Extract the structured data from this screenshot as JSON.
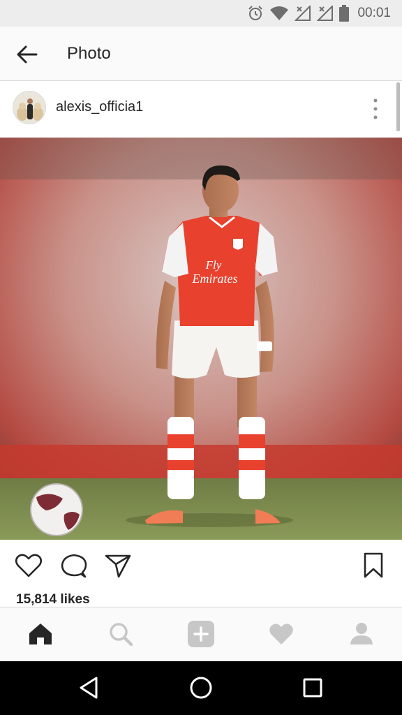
{
  "status_bar": {
    "time": "00:01",
    "icons": [
      "alarm-icon",
      "wifi-icon",
      "signal-icon",
      "signal-icon",
      "battery-icon"
    ]
  },
  "app_bar": {
    "title": "Photo",
    "back_icon": "arrow-left-icon"
  },
  "post": {
    "username": "alexis_officia1",
    "more_icon": "vertical-dots-icon",
    "photo": {
      "jersey_sponsor_line1": "Fly",
      "jersey_sponsor_line2": "Emirates"
    },
    "actions": [
      "heart-icon",
      "comment-icon",
      "send-icon",
      "bookmark-icon"
    ],
    "likes_text": "15,814 likes"
  },
  "bottom_nav": {
    "items": [
      "home-icon",
      "search-icon",
      "add-icon",
      "heart-icon",
      "profile-icon"
    ]
  },
  "system_nav": {
    "items": [
      "back-triangle-icon",
      "home-circle-icon",
      "recents-square-icon"
    ]
  },
  "colors": {
    "status_bar": "#ededed",
    "app_bar": "#fafafa",
    "text": "#262626",
    "inactive_icon": "#c7c7c7",
    "jersey_red": "#e8412e",
    "pitch_green": "#7a8a4a"
  }
}
